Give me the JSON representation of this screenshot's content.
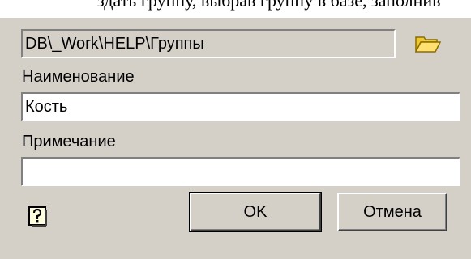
{
  "top_strip": {
    "partial_text": "здать группу, выбрав группу в базе, заполнив"
  },
  "dialog": {
    "path_value": "DB\\_Work\\HELP\\Группы",
    "name_label": "Наименование",
    "name_value": "Кость",
    "note_label": "Примечание",
    "note_value": "",
    "ok_label": "OK",
    "cancel_label": "Отмена",
    "icons": {
      "browse": "folder-open-icon",
      "help": "help-question-icon"
    },
    "colors": {
      "dialog_background": "#d4d0c8",
      "folder_icon": "#f0c832"
    }
  }
}
